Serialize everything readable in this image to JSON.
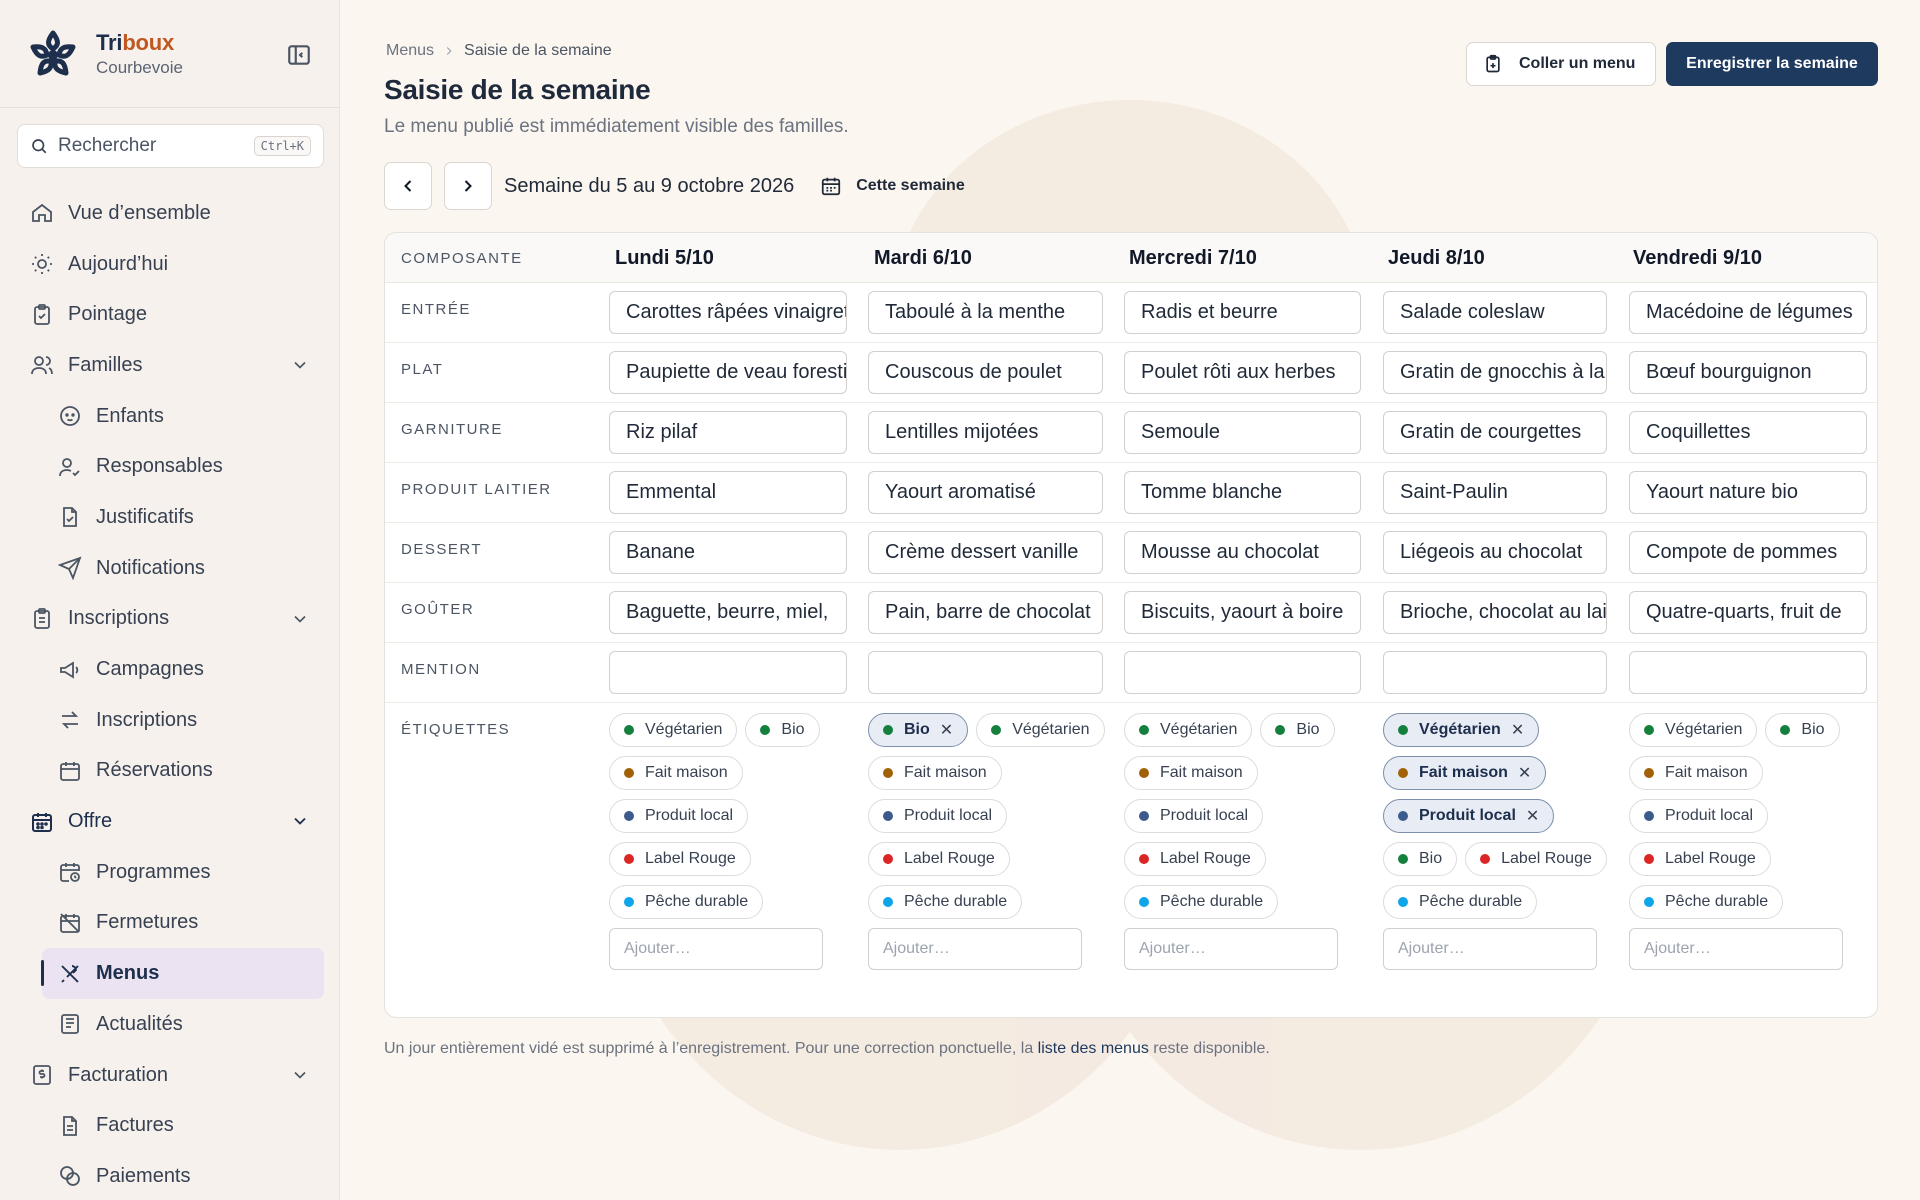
{
  "brand": {
    "name_prefix": "Tri",
    "name_accent": "boux",
    "city": "Courbevoie"
  },
  "search": {
    "placeholder": "Rechercher",
    "shortcut": "Ctrl+K"
  },
  "sidebar": {
    "items": [
      {
        "label": "Vue d’ensemble",
        "icon": "home-icon"
      },
      {
        "label": "Aujourd’hui",
        "icon": "sun-icon"
      },
      {
        "label": "Pointage",
        "icon": "clipboard-check-icon"
      },
      {
        "label": "Familles",
        "icon": "users-icon",
        "expanded": true
      },
      {
        "label": "Enfants",
        "icon": "baby-icon"
      },
      {
        "label": "Responsables",
        "icon": "user-check-icon"
      },
      {
        "label": "Justificatifs",
        "icon": "file-check-icon"
      },
      {
        "label": "Notifications",
        "icon": "send-icon"
      },
      {
        "label": "Inscriptions",
        "icon": "clipboard-list-icon",
        "expanded": true
      },
      {
        "label": "Campagnes",
        "icon": "megaphone-icon"
      },
      {
        "label": "Inscriptions",
        "icon": "arrows-exchange-icon"
      },
      {
        "label": "Réservations",
        "icon": "calendar-icon"
      },
      {
        "label": "Offre",
        "icon": "calendar-grid-icon",
        "expanded": true
      },
      {
        "label": "Programmes",
        "icon": "calendar-clock-icon"
      },
      {
        "label": "Fermetures",
        "icon": "calendar-off-icon"
      },
      {
        "label": "Menus",
        "icon": "utensils-icon",
        "active": true
      },
      {
        "label": "Actualités",
        "icon": "newspaper-icon"
      },
      {
        "label": "Facturation",
        "icon": "receipt-icon",
        "expanded": true
      },
      {
        "label": "Factures",
        "icon": "file-invoice-icon"
      },
      {
        "label": "Paiements",
        "icon": "coins-icon"
      }
    ]
  },
  "breadcrumb": {
    "parent": "Menus",
    "current": "Saisie de la semaine"
  },
  "page": {
    "title": "Saisie de la semaine",
    "subtitle": "Le menu publié est immédiatement visible des familles."
  },
  "actions": {
    "paste_label": "Coller un menu",
    "save_label": "Enregistrer la semaine"
  },
  "week": {
    "label": "Semaine du 5 au 9 octobre 2026",
    "today_label": "Cette semaine"
  },
  "table": {
    "component_header": "COMPOSANTE",
    "days": [
      "Lundi 5/10",
      "Mardi 6/10",
      "Mercredi 7/10",
      "Jeudi 8/10",
      "Vendredi 9/10"
    ],
    "rows": [
      {
        "label": "ENTRÉE",
        "values": [
          "Carottes râpées vinaigrette",
          "Taboulé à la menthe",
          "Radis et beurre",
          "Salade coleslaw",
          "Macédoine de légumes"
        ]
      },
      {
        "label": "PLAT",
        "values": [
          "Paupiette de veau forestière",
          "Couscous de poulet",
          "Poulet rôti aux herbes",
          "Gratin de gnocchis à la",
          "Bœuf bourguignon"
        ]
      },
      {
        "label": "GARNITURE",
        "values": [
          "Riz pilaf",
          "Lentilles mijotées",
          "Semoule",
          "Gratin de courgettes",
          "Coquillettes"
        ]
      },
      {
        "label": "PRODUIT LAITIER",
        "values": [
          "Emmental",
          "Yaourt aromatisé",
          "Tomme blanche",
          "Saint-Paulin",
          "Yaourt nature bio"
        ]
      },
      {
        "label": "DESSERT",
        "values": [
          "Banane",
          "Crème dessert vanille",
          "Mousse au chocolat",
          "Liégeois au chocolat",
          "Compote de pommes"
        ]
      },
      {
        "label": "GOÛTER",
        "values": [
          "Baguette, beurre, miel,",
          "Pain, barre de chocolat",
          "Biscuits, yaourt à boire",
          "Brioche, chocolat au lait",
          "Quatre-quarts, fruit de"
        ]
      },
      {
        "label": "MENTION",
        "values": [
          "",
          "",
          "",
          "",
          ""
        ]
      }
    ],
    "tags_label": "ÉTIQUETTES",
    "add_placeholder": "Ajouter…",
    "tag_colors": {
      "Végétarien": "#15803d",
      "Bio": "#15803d",
      "Fait maison": "#a16207",
      "Produit local": "#3b5b8c",
      "Label Rouge": "#dc2626",
      "Pêche durable": "#0ea5e9"
    },
    "tags": [
      [
        {
          "name": "Végétarien",
          "selected": false
        },
        {
          "name": "Bio",
          "selected": false
        },
        {
          "name": "Fait maison",
          "selected": false
        },
        {
          "name": "Produit local",
          "selected": false
        },
        {
          "name": "Label Rouge",
          "selected": false
        },
        {
          "name": "Pêche durable",
          "selected": false
        }
      ],
      [
        {
          "name": "Bio",
          "selected": true
        },
        {
          "name": "Végétarien",
          "selected": false
        },
        {
          "name": "Fait maison",
          "selected": false
        },
        {
          "name": "Produit local",
          "selected": false
        },
        {
          "name": "Label Rouge",
          "selected": false
        },
        {
          "name": "Pêche durable",
          "selected": false
        }
      ],
      [
        {
          "name": "Végétarien",
          "selected": false
        },
        {
          "name": "Bio",
          "selected": false
        },
        {
          "name": "Fait maison",
          "selected": false
        },
        {
          "name": "Produit local",
          "selected": false
        },
        {
          "name": "Label Rouge",
          "selected": false
        },
        {
          "name": "Pêche durable",
          "selected": false
        }
      ],
      [
        {
          "name": "Végétarien",
          "selected": true
        },
        {
          "name": "Fait maison",
          "selected": true
        },
        {
          "name": "Produit local",
          "selected": true
        },
        {
          "name": "Bio",
          "selected": false
        },
        {
          "name": "Label Rouge",
          "selected": false
        },
        {
          "name": "Pêche durable",
          "selected": false
        }
      ],
      [
        {
          "name": "Végétarien",
          "selected": false
        },
        {
          "name": "Bio",
          "selected": false
        },
        {
          "name": "Fait maison",
          "selected": false
        },
        {
          "name": "Produit local",
          "selected": false
        },
        {
          "name": "Label Rouge",
          "selected": false
        },
        {
          "name": "Pêche durable",
          "selected": false
        }
      ]
    ]
  },
  "footnote": {
    "before": "Un jour entièrement vidé est supprimé à l’enregistrement. Pour une correction ponctuelle, la ",
    "link": "liste des menus",
    "after": " reste disponible."
  },
  "colors": {
    "primary": "#1f3a5f",
    "accent": "#c0571f",
    "active_bg": "#ebe3f2"
  }
}
